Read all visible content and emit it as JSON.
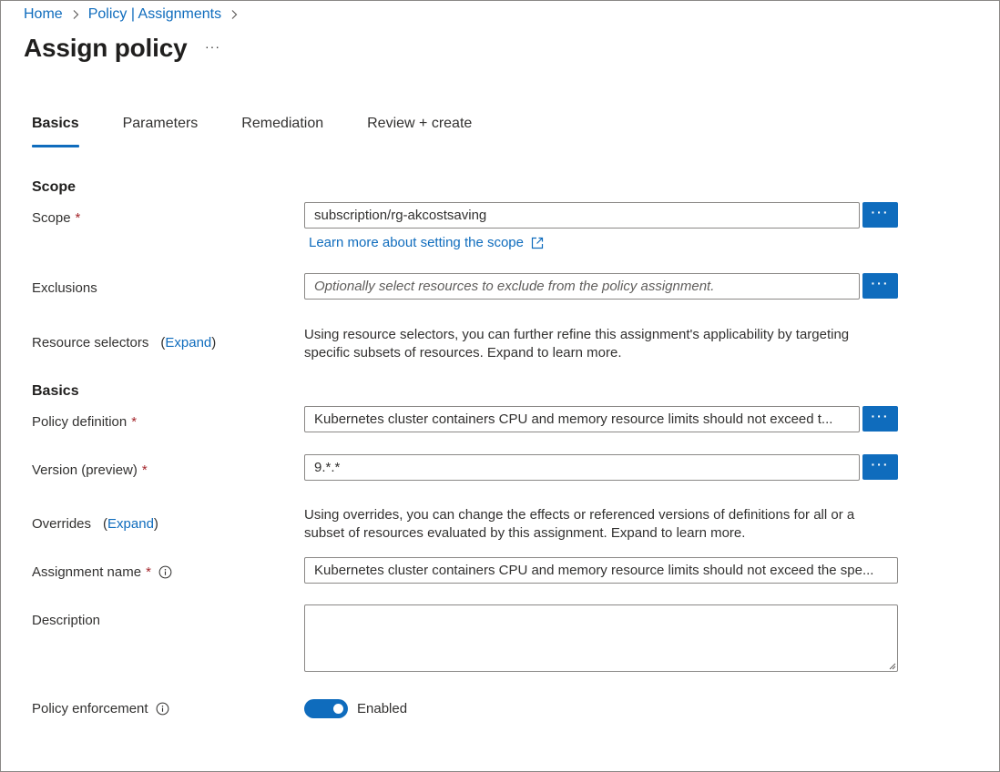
{
  "breadcrumb": {
    "home": "Home",
    "policy": "Policy | Assignments"
  },
  "page": {
    "title": "Assign policy",
    "more": "···"
  },
  "tabs": [
    {
      "label": "Basics",
      "active": true
    },
    {
      "label": "Parameters"
    },
    {
      "label": "Remediation"
    },
    {
      "label": "Review + create"
    }
  ],
  "scope_section": {
    "heading": "Scope",
    "scope_label": "Scope",
    "scope_value": "subscription/rg-akcostsaving",
    "learn_more": "Learn more about setting the scope",
    "exclusions_label": "Exclusions",
    "exclusions_placeholder": "Optionally select resources to exclude from the policy assignment.",
    "resource_selectors_label": "Resource selectors",
    "resource_selectors_expand": "Expand",
    "resource_selectors_desc": "Using resource selectors, you can further refine this assignment's applicability by targeting specific subsets of resources. Expand to learn more."
  },
  "basics_section": {
    "heading": "Basics",
    "policy_definition_label": "Policy definition",
    "policy_definition_value": "Kubernetes cluster containers CPU and memory resource limits should not exceed t...",
    "version_label": "Version (preview)",
    "version_value": "9.*.*",
    "overrides_label": "Overrides",
    "overrides_expand": "Expand",
    "overrides_desc": "Using overrides, you can change the effects or referenced versions of definitions for all or a subset of resources evaluated by this assignment. Expand to learn more.",
    "assignment_name_label": "Assignment name",
    "assignment_name_value": "Kubernetes cluster containers CPU and memory resource limits should not exceed the spe...",
    "description_label": "Description",
    "description_value": "",
    "policy_enforcement_label": "Policy enforcement",
    "policy_enforcement_state": "Enabled",
    "policy_enforcement_on": true
  },
  "required_marker": "*",
  "ellipsis_button": "···",
  "colors": {
    "accent": "#0f6cbd",
    "required": "#a4262c",
    "border": "#8a8886"
  }
}
